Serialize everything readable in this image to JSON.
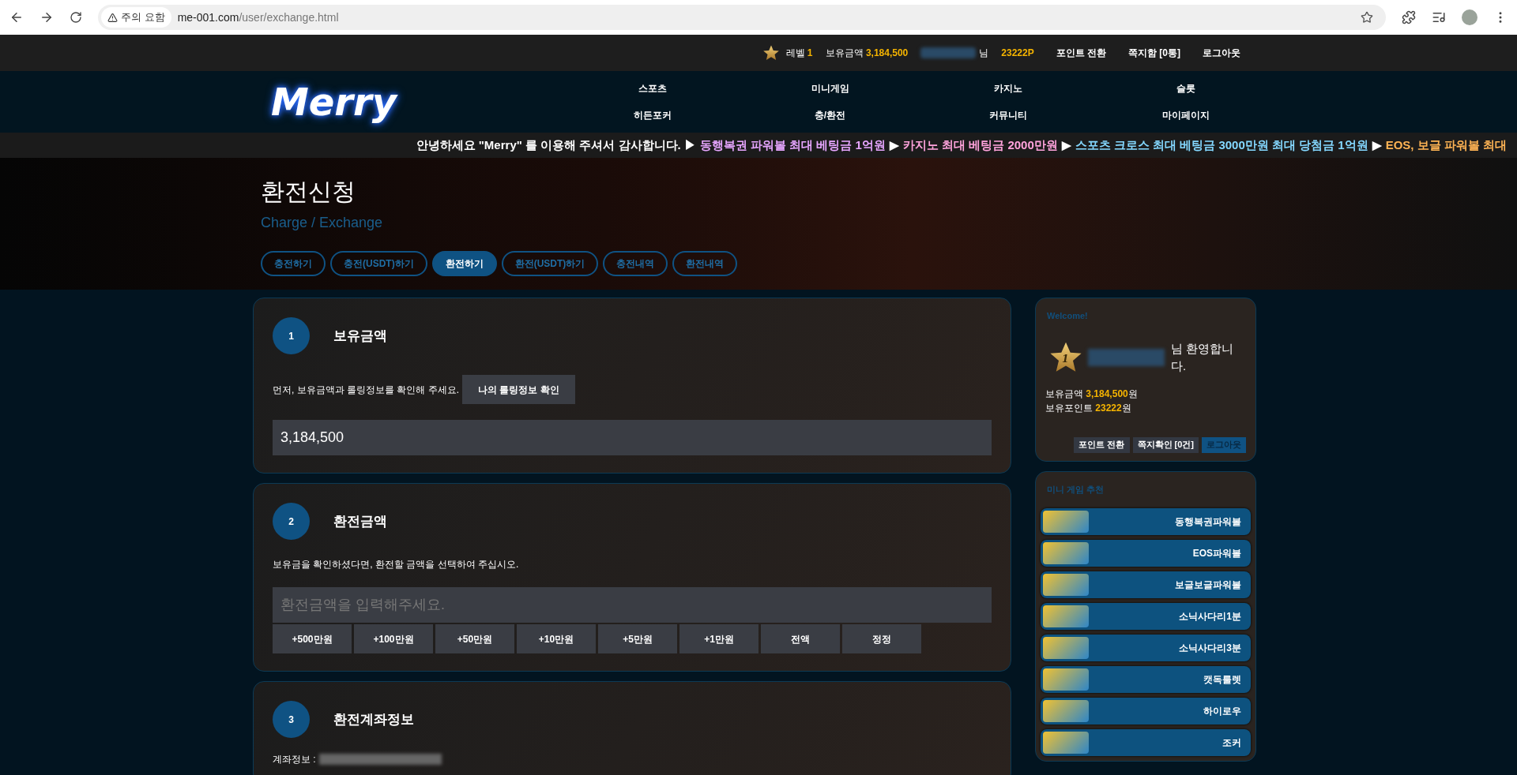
{
  "browser": {
    "security": "주의 요함",
    "url_host": "me-001.com",
    "url_path": "/user/exchange.html"
  },
  "top_bar": {
    "level_label": "레벨",
    "level_value": "1",
    "balance_label": "보유금액",
    "balance_value": "3,184,500",
    "name_suffix": "님",
    "points": "23222P",
    "links": [
      "포인트 전환",
      "쪽지함 [0통]",
      "로그아웃"
    ]
  },
  "logo": "Merry",
  "nav": [
    "스포츠",
    "미니게임",
    "카지노",
    "슬롯",
    "히든포커",
    "충/환전",
    "커뮤니티",
    "마이페이지"
  ],
  "marquee": [
    {
      "text": "안녕하세요 \"Merry\" 를 이용해 주셔서 감사합니다. ▶",
      "color": "#ffffff"
    },
    {
      "text": "동행복권 파워볼 최대 베팅금 1억원",
      "color": "#e7a6ff"
    },
    {
      "text": "▶",
      "color": "#ffffff"
    },
    {
      "text": "카지노 최대 베팅금 2000만원",
      "color": "#ffa3dc"
    },
    {
      "text": "▶",
      "color": "#ffffff"
    },
    {
      "text": "스포츠 크로스 최대 베팅금 3000만원 최대 당첨금 1억원",
      "color": "#84d8ff"
    },
    {
      "text": "▶",
      "color": "#ffffff"
    },
    {
      "text": "EOS, 보글 파워볼 최대",
      "color": "#ffb454"
    }
  ],
  "hero": {
    "title": "환전신청",
    "subtitle": "Charge / Exchange"
  },
  "tabs": [
    {
      "label": "충전하기",
      "selected": false
    },
    {
      "label": "충전(USDT)하기",
      "selected": false
    },
    {
      "label": "환전하기",
      "selected": true
    },
    {
      "label": "환전(USDT)하기",
      "selected": false
    },
    {
      "label": "충전내역",
      "selected": false
    },
    {
      "label": "환전내역",
      "selected": false
    }
  ],
  "sections": [
    {
      "number": "1",
      "title": "보유금액",
      "text": "먼저, 보유금액과 롤링정보를 확인해 주세요.",
      "button": "나의 롤링정보 확인",
      "field_value": "3,184,500"
    },
    {
      "number": "2",
      "title": "환전금액",
      "text": "보유금을 확인하셨다면, 환전할 금액을 선택하여 주십시오.",
      "placeholder": "환전금액을 입력해주세요.",
      "amount_buttons": [
        "+500만원",
        "+100만원",
        "+50만원",
        "+10만원",
        "+5만원",
        "+1만원",
        "전액",
        "정정"
      ]
    },
    {
      "number": "3",
      "title": "환전계좌정보",
      "account_label": "계좌정보 :"
    }
  ],
  "welcome": {
    "heading": "Welcome!",
    "level": "1",
    "greeting": "님 환영합니다.",
    "balance_label": "보유금액",
    "balance_value": "3,184,500",
    "balance_unit": "원",
    "points_label": "보유포인트",
    "points_value": "23222",
    "points_unit": "원",
    "buttons": [
      {
        "label": "포인트 전환",
        "kind": "normal"
      },
      {
        "label": "쪽지확인 [0건]",
        "kind": "normal"
      },
      {
        "label": "로그아웃",
        "kind": "accent"
      }
    ]
  },
  "mini_games": {
    "heading": "미니 게임 추천",
    "items": [
      "동행복권파워볼",
      "EOS파워볼",
      "보글보글파워볼",
      "소닉사다리1분",
      "소닉사다리3분",
      "캣독룰렛",
      "하이로우",
      "조커"
    ]
  }
}
